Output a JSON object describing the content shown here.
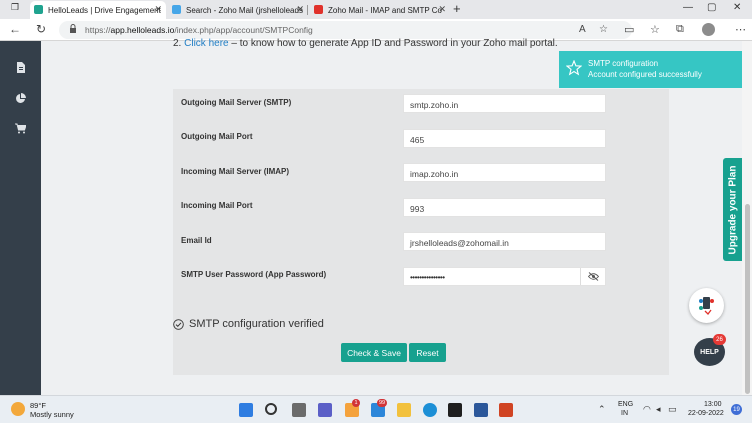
{
  "browser": {
    "tabs": [
      {
        "title": "HelloLeads | Drive Engagement",
        "active": true,
        "color": "#1fa38f"
      },
      {
        "title": "Search - Zoho Mail (jrshelloleads",
        "active": false,
        "color": "#46a6e8"
      },
      {
        "title": "Zoho Mail - IMAP and SMTP Co",
        "active": false,
        "color": "#e0312b"
      }
    ],
    "new_tab": "+",
    "url_prefix": "https://",
    "url_domain": "app.helloleads.io",
    "url_path": "/index.php/app/account/SMTPConfig"
  },
  "page": {
    "help_line_prefix": "2. ",
    "help_link": "Click here",
    "help_line_suffix": " – to know how to generate App ID and Password in your Zoho mail portal.",
    "fields": [
      {
        "label": "Outgoing Mail Server (SMTP)",
        "value": "smtp.zoho.in"
      },
      {
        "label": "Outgoing Mail Port",
        "value": "465"
      },
      {
        "label": "Incoming Mail Server (IMAP)",
        "value": "imap.zoho.in"
      },
      {
        "label": "Incoming Mail Port",
        "value": "993"
      },
      {
        "label": "Email Id",
        "value": "jrshelloleads@zohomail.in"
      },
      {
        "label": "SMTP User Password (App Password)",
        "value": "•••••••••••••••"
      }
    ],
    "verified_text": "SMTP configuration verified",
    "check_save_label": "Check & Save",
    "reset_label": "Reset"
  },
  "toast": {
    "title": "SMTP configuration",
    "message": "Account configured successfully"
  },
  "upgrade_label": "Upgrade your Plan",
  "help_widget": {
    "label": "HELP",
    "badge": "26"
  },
  "taskbar": {
    "temperature": "89°F",
    "weather": "Mostly sunny",
    "badges": [
      "1",
      "99"
    ],
    "lang_line1": "ENG",
    "lang_line2": "IN",
    "time": "13:00",
    "date": "22-09-2022",
    "notification_count": "19"
  },
  "colors": {
    "accent": "#17a18f",
    "toast": "#36c6c4",
    "sidebar": "#343f4a",
    "link": "#1f7dc4"
  }
}
